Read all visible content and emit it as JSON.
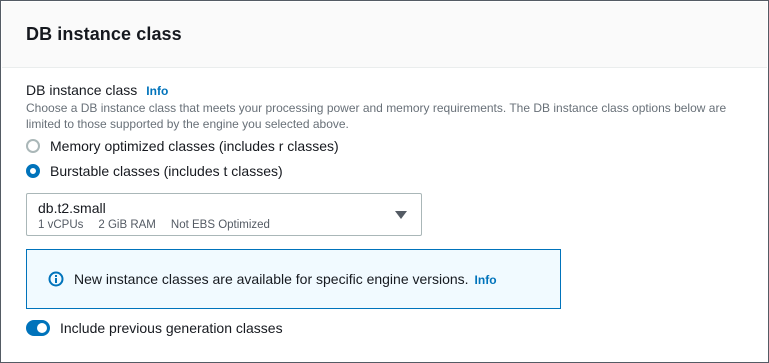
{
  "panel": {
    "title": "DB instance class"
  },
  "field": {
    "label": "DB instance class",
    "info_label": "Info",
    "description": "Choose a DB instance class that meets your processing power and memory requirements. The DB instance class options below are limited to those supported by the engine you selected above."
  },
  "radio_options": [
    {
      "label": "Memory optimized classes (includes r classes)",
      "checked": false
    },
    {
      "label": "Burstable classes (includes t classes)",
      "checked": true
    }
  ],
  "instance_select": {
    "value": "db.t2.small",
    "vcpus": "1 vCPUs",
    "ram": "2 GiB RAM",
    "ebs": "Not EBS Optimized",
    "icon": "caret-down-icon"
  },
  "alert": {
    "icon": "info-circle-icon",
    "text": "New instance classes are available for specific engine versions.",
    "info_label": "Info",
    "accent_color": "#0073bb",
    "background_color": "#f1faff"
  },
  "toggle": {
    "label": "Include previous generation classes",
    "checked": true
  },
  "colors": {
    "link": "#0073bb",
    "text": "#16191f",
    "secondary_text": "#687078"
  }
}
